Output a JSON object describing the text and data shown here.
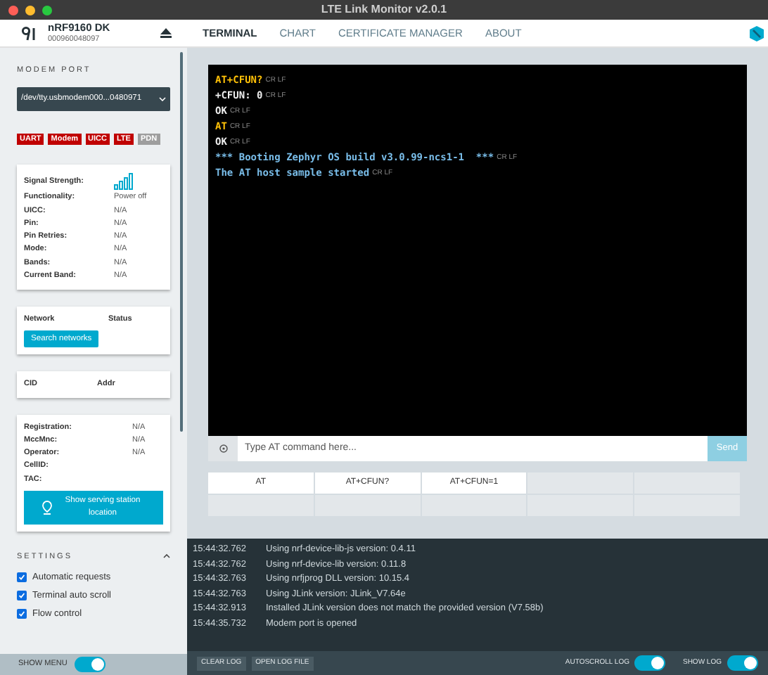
{
  "window": {
    "title": "LTE Link Monitor v2.0.1"
  },
  "device": {
    "name": "nRF9160 DK",
    "serial": "000960048097"
  },
  "tabs": [
    {
      "label": "TERMINAL",
      "selected": true
    },
    {
      "label": "CHART",
      "selected": false
    },
    {
      "label": "CERTIFICATE MANAGER",
      "selected": false
    },
    {
      "label": "ABOUT",
      "selected": false
    }
  ],
  "sidebar": {
    "modem_port": {
      "label": "MODEM PORT",
      "value": "/dev/tty.usbmodem000...0480971"
    },
    "badges": [
      {
        "label": "UART",
        "color": "#c00000"
      },
      {
        "label": "Modem",
        "color": "#c00000"
      },
      {
        "label": "UICC",
        "color": "#c00000"
      },
      {
        "label": "LTE",
        "color": "#c00000"
      },
      {
        "label": "PDN",
        "color": "#9e9e9e"
      }
    ],
    "status": [
      {
        "label": "Signal Strength:",
        "kind": "signal"
      },
      {
        "label": "Functionality:",
        "value": "Power off"
      },
      {
        "label": "UICC:",
        "value": "N/A"
      },
      {
        "label": "Pin:",
        "value": "N/A"
      },
      {
        "label": "Pin Retries:",
        "value": "N/A"
      },
      {
        "label": "Mode:",
        "value": "N/A"
      },
      {
        "label": "Bands:",
        "value": "N/A"
      },
      {
        "label": "Current Band:",
        "value": "N/A"
      }
    ],
    "network": {
      "columns": [
        "Network",
        "Status"
      ],
      "button": "Search networks"
    },
    "pdn": {
      "columns": [
        "CID",
        "Addr"
      ]
    },
    "cell": [
      {
        "label": "Registration:",
        "value": "N/A"
      },
      {
        "label": "MccMnc:",
        "value": "N/A"
      },
      {
        "label": "Operator:",
        "value": "N/A"
      },
      {
        "label": "CellID:"
      },
      {
        "label": "TAC:"
      }
    ],
    "location_button": "Show serving station location",
    "settings": {
      "title": "SETTINGS",
      "expanded": true,
      "options": [
        {
          "label": "Automatic requests",
          "checked": true
        },
        {
          "label": "Terminal auto scroll",
          "checked": true
        },
        {
          "label": "Flow control",
          "checked": true
        }
      ]
    },
    "show_menu": {
      "label": "SHOW MENU",
      "on": true
    }
  },
  "terminal": {
    "lines": [
      {
        "kind": "command",
        "text": "AT+CFUN?",
        "end": "CR LF"
      },
      {
        "kind": "response",
        "text": "+CFUN: 0",
        "end": "CR LF"
      },
      {
        "kind": "response",
        "text": "OK",
        "end": "CR LF"
      },
      {
        "kind": "command",
        "text": "AT",
        "end": "CR LF"
      },
      {
        "kind": "response",
        "text": "OK",
        "end": "CR LF"
      },
      {
        "kind": "info",
        "text": "*** Booting Zephyr OS build v3.0.99-ncs1-1  ***",
        "end": "CR LF"
      },
      {
        "kind": "info",
        "text": "The AT host sample started",
        "end": "CR LF"
      }
    ],
    "input": {
      "placeholder": "Type AT command here..."
    },
    "send": "Send",
    "quick_commands": [
      "AT",
      "AT+CFUN?",
      "AT+CFUN=1"
    ]
  },
  "log": {
    "entries": [
      {
        "time": "15:44:32.762",
        "message": "Using nrf-device-lib-js version: 0.4.11"
      },
      {
        "time": "15:44:32.762",
        "message": "Using nrf-device-lib version: 0.11.8"
      },
      {
        "time": "15:44:32.763",
        "message": "Using nrfjprog DLL version: 10.15.4"
      },
      {
        "time": "15:44:32.763",
        "message": "Using JLink version: JLink_V7.64e"
      },
      {
        "time": "15:44:32.913",
        "message": "Installed JLink version does not match the provided version (V7.58b)"
      },
      {
        "time": "15:44:35.732",
        "message": "Modem port is opened"
      }
    ],
    "buttons": [
      "CLEAR LOG",
      "OPEN LOG FILE"
    ],
    "toggles": [
      {
        "label": "AUTOSCROLL LOG",
        "on": true
      },
      {
        "label": "SHOW LOG",
        "on": true
      }
    ]
  }
}
